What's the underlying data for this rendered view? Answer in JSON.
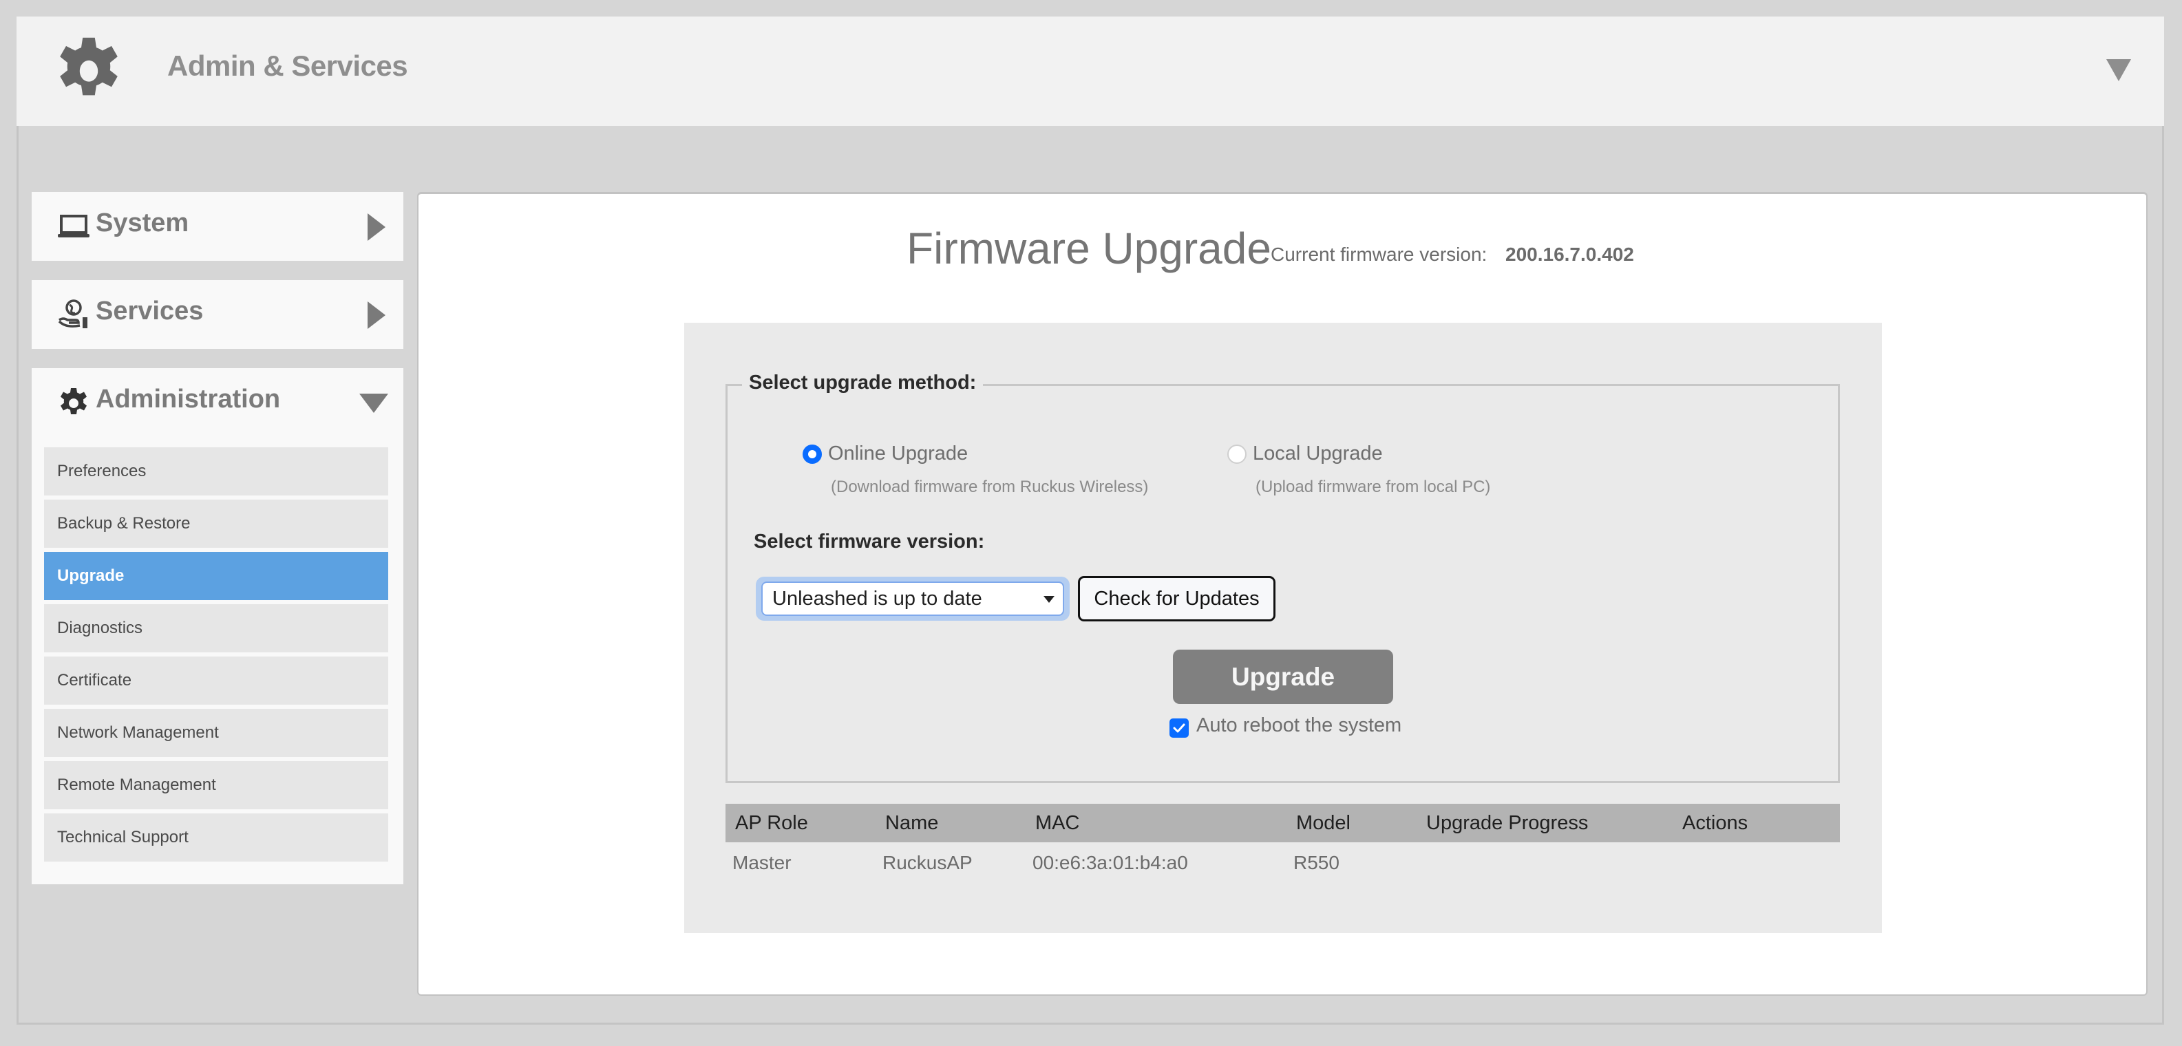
{
  "header": {
    "title": "Admin & Services",
    "icon": "gear-icon",
    "menu_icon": "caret-down-icon"
  },
  "sidebar": {
    "sections": [
      {
        "label": "System",
        "icon": "laptop-icon",
        "expanded": false
      },
      {
        "label": "Services",
        "icon": "globe-hand-icon",
        "expanded": false
      },
      {
        "label": "Administration",
        "icon": "gear-icon",
        "expanded": true
      }
    ],
    "admin_items": [
      {
        "label": "Preferences",
        "active": false
      },
      {
        "label": "Backup & Restore",
        "active": false
      },
      {
        "label": "Upgrade",
        "active": true
      },
      {
        "label": "Diagnostics",
        "active": false
      },
      {
        "label": "Certificate",
        "active": false
      },
      {
        "label": "Network Management",
        "active": false
      },
      {
        "label": "Remote Management",
        "active": false
      },
      {
        "label": "Technical Support",
        "active": false
      }
    ]
  },
  "main": {
    "title": "Firmware Upgrade",
    "current_version_label": "Current firmware version:",
    "current_version": "200.16.7.0.402",
    "method_legend": "Select upgrade method:",
    "methods": [
      {
        "label": "Online Upgrade",
        "hint": "(Download firmware from Ruckus Wireless)",
        "selected": true
      },
      {
        "label": "Local Upgrade",
        "hint": "(Upload firmware from local PC)",
        "selected": false
      }
    ],
    "version_label": "Select firmware version:",
    "version_select": {
      "value": "Unleashed is up to date"
    },
    "check_button": "Check for Updates",
    "upgrade_button": "Upgrade",
    "auto_reboot": {
      "label": "Auto reboot the system",
      "checked": true
    },
    "table": {
      "columns": [
        "AP Role",
        "Name",
        "MAC",
        "Model",
        "Upgrade Progress",
        "Actions"
      ],
      "rows": [
        [
          "Master",
          "RuckusAP",
          "00:e6:3a:01:b4:a0",
          "R550",
          "",
          ""
        ]
      ]
    }
  },
  "colors": {
    "accent": "#5ca1e1",
    "radio_blue": "#0a6cff",
    "upgrade_button": "#808080"
  }
}
